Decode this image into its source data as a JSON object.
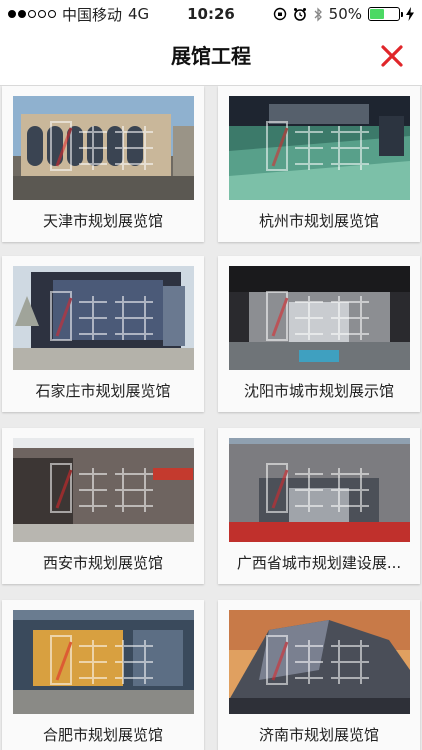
{
  "status_bar": {
    "carrier": "中国移动",
    "network": "4G",
    "time": "10:26",
    "battery": "50%",
    "battery_level": 0.5
  },
  "nav": {
    "title": "展馆工程",
    "close_icon": "close-icon"
  },
  "colors": {
    "accent_red": "#e0262a",
    "background": "#ebebeb"
  },
  "cards": [
    {
      "label": "天津市规划展览馆"
    },
    {
      "label": "杭州市规划展览馆"
    },
    {
      "label": "石家庄市规划展览馆"
    },
    {
      "label": "沈阳市城市规划展示馆"
    },
    {
      "label": "西安市规划展览馆"
    },
    {
      "label": "广西省城市规划建设展..."
    },
    {
      "label": "合肥市规划展览馆"
    },
    {
      "label": "济南市规划展览馆"
    }
  ]
}
